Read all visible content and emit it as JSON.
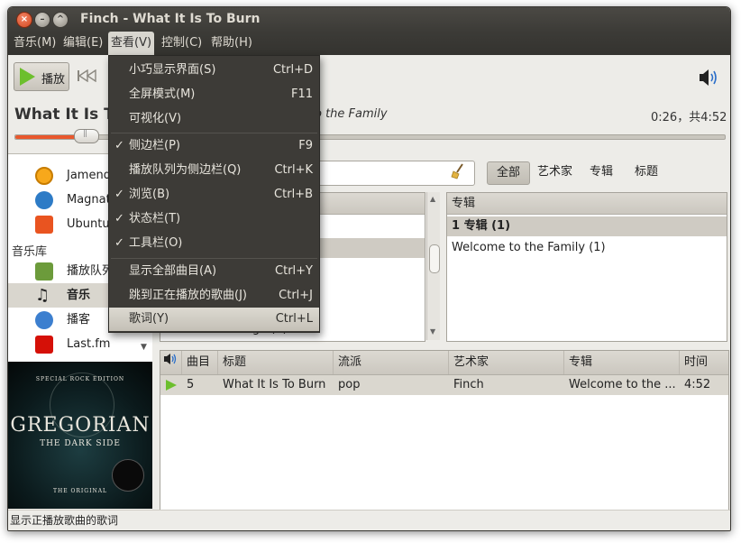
{
  "window": {
    "title": "Finch - What It Is To Burn"
  },
  "menubar": [
    {
      "label": "音乐(M)"
    },
    {
      "label": "编辑(E)"
    },
    {
      "label": "查看(V)"
    },
    {
      "label": "控制(C)"
    },
    {
      "label": "帮助(H)"
    }
  ],
  "view_menu": [
    {
      "label": "小巧显示界面(S)",
      "accel": "Ctrl+D",
      "check": ""
    },
    {
      "label": "全屏模式(M)",
      "accel": "F11",
      "check": ""
    },
    {
      "label": "可视化(V)",
      "accel": "",
      "check": ""
    },
    {
      "label": "侧边栏(P)",
      "accel": "F9",
      "check": "✓"
    },
    {
      "label": "播放队列为侧边栏(Q)",
      "accel": "Ctrl+K",
      "check": ""
    },
    {
      "label": "浏览(B)",
      "accel": "Ctrl+B",
      "check": "✓"
    },
    {
      "label": "状态栏(T)",
      "accel": "",
      "check": "✓"
    },
    {
      "label": "工具栏(O)",
      "accel": "",
      "check": "✓"
    },
    {
      "label": "显示全部曲目(A)",
      "accel": "Ctrl+Y",
      "check": ""
    },
    {
      "label": "跳到正在播放的歌曲(J)",
      "accel": "Ctrl+J",
      "check": ""
    },
    {
      "label": "歌词(Y)",
      "accel": "Ctrl+L",
      "check": ""
    }
  ],
  "toolbar": {
    "play_label": "播放"
  },
  "now_playing": {
    "title": "What It Is T",
    "album_fragment": "o the Family",
    "time": "0:26，共4:52",
    "progress": 0.09
  },
  "sidebar": {
    "items_top": [
      {
        "label": "Jamend"
      },
      {
        "label": "Magnat"
      },
      {
        "label": "Ubuntu"
      }
    ],
    "library_header": "音乐库",
    "items_library": [
      {
        "label": "播放队列"
      },
      {
        "label": "音乐"
      },
      {
        "label": "播客"
      },
      {
        "label": "Last.fm"
      }
    ]
  },
  "album_art": {
    "top_text": "SPECIAL ROCK EDITION",
    "name": "GREGORIAN",
    "subtitle": "THE DARK SIDE",
    "bottom_text": "THE ORIGINAL"
  },
  "browser": {
    "filters": [
      "全部",
      "艺术家",
      "专辑",
      "标题"
    ],
    "album_pane": {
      "header": "专辑",
      "rows": [
        "1 专辑 (1)",
        "Welcome to the Family (1)"
      ]
    },
    "artist_pane": {
      "partial_row": "Groove Coverage (3)"
    }
  },
  "tracklist": {
    "columns": [
      "曲目",
      "标题",
      "流派",
      "艺术家",
      "专辑",
      "时间"
    ],
    "rows": [
      {
        "track": "5",
        "title": "What It Is To Burn",
        "genre": "pop",
        "artist": "Finch",
        "album": "Welcome to the ...",
        "time": "4:52"
      }
    ]
  },
  "statusbar": {
    "text": "显示正播放歌曲的歌词"
  },
  "colors": {
    "dark_chrome": "#3c3b37",
    "accent_orange": "#e9582d",
    "play_green": "#6cbf2d"
  }
}
